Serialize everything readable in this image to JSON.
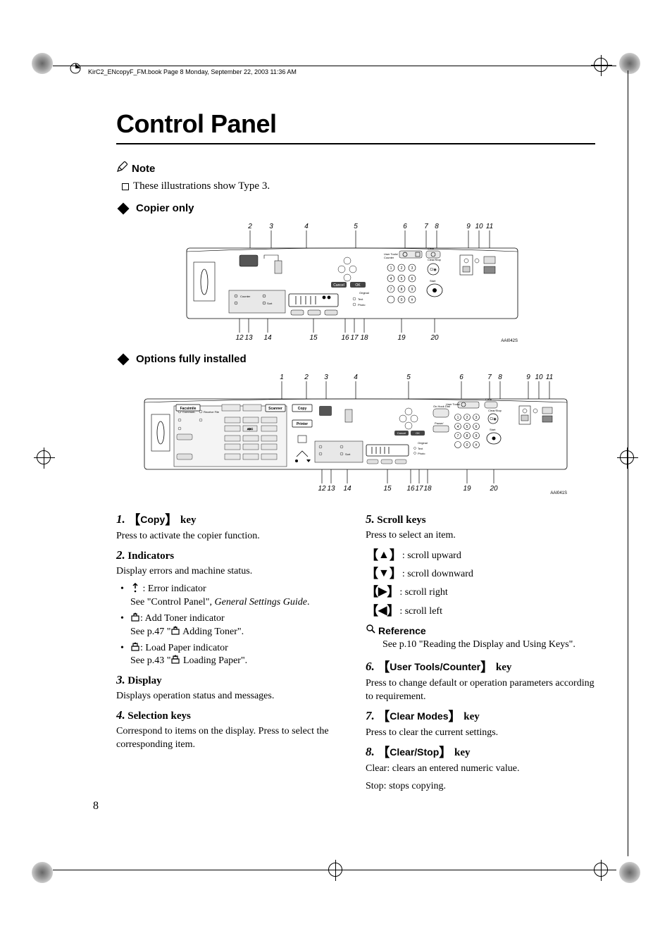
{
  "header": {
    "running_text": "KirC2_ENcopyF_FM.book  Page 8  Monday, September 22, 2003  11:36 AM"
  },
  "title": "Control Panel",
  "note": {
    "label": "Note",
    "text": "These illustrations show Type 3."
  },
  "sections": {
    "copier_only": "Copier only",
    "options_full": "Options fully installed"
  },
  "diagram1": {
    "top_labels": [
      "2",
      "3",
      "4",
      "5",
      "6",
      "7",
      "8",
      "9",
      "10",
      "11"
    ],
    "bottom_labels": [
      "12",
      "13",
      "14",
      "15",
      "16",
      "17",
      "18",
      "19",
      "20"
    ],
    "code": "AAI042S"
  },
  "diagram2": {
    "top_labels": [
      "1",
      "2",
      "3",
      "4",
      "5",
      "6",
      "7",
      "8",
      "9",
      "10",
      "11"
    ],
    "bottom_labels": [
      "12",
      "13",
      "14",
      "15",
      "16",
      "17",
      "18",
      "19",
      "20"
    ],
    "code": "AAI041S",
    "buttons": [
      "Facsimile",
      "Scanner",
      "Copy",
      "Printer"
    ]
  },
  "items": [
    {
      "num": "1.",
      "title_sans": "Copy",
      "suffix": " key",
      "desc": "Press to activate the copier function."
    },
    {
      "num": "2.",
      "title": "Indicators",
      "desc": "Display errors and machine status.",
      "bullets": [
        {
          "icon": "error",
          "text": "Error indicator",
          "hint": "See \"Control Panel\", ",
          "hint_em": "General Settings Guide",
          "hint_after": "."
        },
        {
          "icon": "toner",
          "text": "Add Toner indicator",
          "hint": "See p.47 \"",
          "hint_icon": "toner",
          "hint_after": " Adding Toner\"."
        },
        {
          "icon": "paper",
          "text": "Load Paper indicator",
          "hint": "See p.43 \"",
          "hint_icon": "paper",
          "hint_after": " Loading Paper\"."
        }
      ]
    },
    {
      "num": "3.",
      "title": "Display",
      "desc": "Displays operation status and messages."
    },
    {
      "num": "4.",
      "title": "Selection keys",
      "desc": "Correspond to items on the display. Press to select the corresponding item."
    },
    {
      "num": "5.",
      "title": "Scroll keys",
      "desc": "Press to select an item.",
      "scrolls": [
        {
          "key": "▲",
          "text": "scroll upward"
        },
        {
          "key": "▼",
          "text": "scroll downward"
        },
        {
          "key": "▶",
          "text": "scroll right"
        },
        {
          "key": "◀",
          "text": "scroll left"
        }
      ],
      "ref_label": "Reference",
      "ref_text": "See p.10 \"Reading the Display and Using Keys\"."
    },
    {
      "num": "6.",
      "title_sans": "User Tools/Counter",
      "suffix": " key",
      "desc": "Press to change default or operation parameters according to requirement."
    },
    {
      "num": "7.",
      "title_sans": "Clear Modes",
      "suffix": " key",
      "desc": "Press to clear the current settings."
    },
    {
      "num": "8.",
      "title_sans": "Clear/Stop",
      "suffix": " key",
      "desc": "Clear: clears an entered numeric value.",
      "desc2": "Stop: stops copying."
    }
  ],
  "page_number": "8"
}
